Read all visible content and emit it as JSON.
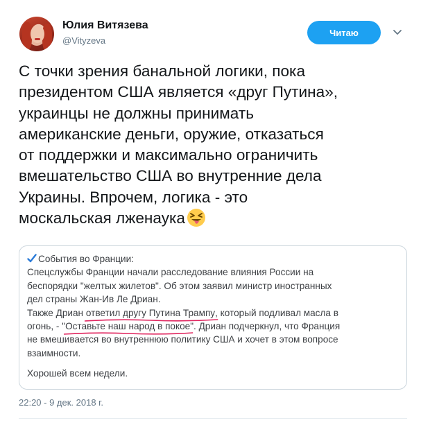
{
  "author": {
    "name": "Юлия Витязева",
    "handle": "@Vityzeva"
  },
  "follow_button": {
    "label": "Читаю"
  },
  "tweet": {
    "lines": [
      "С точки зрения банальной логики, пока",
      "президентом США является «друг Путина»,",
      "украинцы не должны принимать",
      "американские деньги, оружие, отказаться",
      "от поддержки и максимально ограничить",
      "вмешательство США во внутренние дела",
      "Украины. Впрочем, логика - это",
      "москальская лженаука"
    ],
    "emoji": "squinting-face-with-tongue"
  },
  "quote": {
    "title": "События во Франции:",
    "lines": [
      "Спецслужбы Франции начали расследование влияния России на",
      "беспорядки \"желтых жилетов\". Об этом заявил министр иностранных",
      "дел страны Жан-Ив Ле Дриан."
    ],
    "line4_before": "Также Дриан ",
    "line4_underlined": "ответил другу Путина Трампу",
    "line4_after": ", который подливал масла в",
    "line5_before": "огонь, - \"",
    "line5_underlined": "Оставьте наш народ в покое",
    "line5_after": "\". Дриан подчеркнул, что Франция",
    "line6": "не вмешивается во внутреннюю политику США и хочет в этом вопросе",
    "line7": "взаимности.",
    "closing": "Хорошей всем недели.",
    "underline_color": "#e0245e",
    "check_color": "#2b7bd8"
  },
  "timestamp": "22:20 - 9 дек. 2018 г.",
  "colors": {
    "accent": "#1da1f2",
    "text": "#14171a",
    "muted": "#657786",
    "border": "#ccd6dd"
  }
}
